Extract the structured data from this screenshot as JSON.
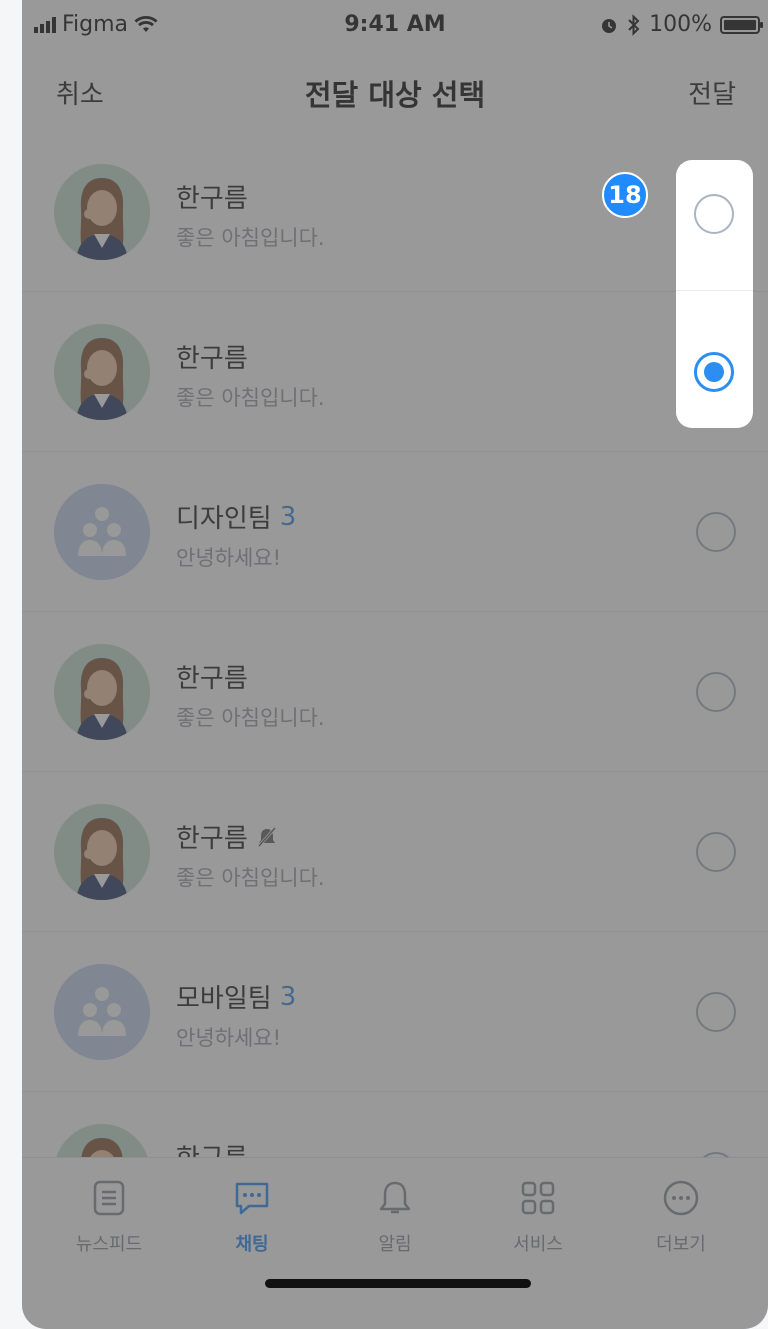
{
  "status_bar": {
    "carrier": "Figma",
    "time": "9:41 AM",
    "battery": "100%"
  },
  "header": {
    "cancel_label": "취소",
    "title": "전달 대상 선택",
    "send_label": "전달"
  },
  "list": [
    {
      "type": "person",
      "name": "한구름",
      "message": "좋은 아침입니다.",
      "selected": false,
      "muted": false
    },
    {
      "type": "person",
      "name": "한구름",
      "message": "좋은 아침입니다.",
      "selected": true,
      "muted": false
    },
    {
      "type": "group",
      "name": "디자인팀",
      "count": "3",
      "message": "안녕하세요!",
      "selected": false,
      "muted": false
    },
    {
      "type": "person",
      "name": "한구름",
      "message": "좋은 아침입니다.",
      "selected": false,
      "muted": false
    },
    {
      "type": "person",
      "name": "한구름",
      "message": "좋은 아침입니다.",
      "selected": false,
      "muted": true
    },
    {
      "type": "group",
      "name": "모바일팀",
      "count": "3",
      "message": "안녕하세요!",
      "selected": false,
      "muted": false
    },
    {
      "type": "person",
      "name": "한구름",
      "message": "",
      "selected": false,
      "muted": false
    }
  ],
  "annotation_badge": "18",
  "tabbar": {
    "items": [
      {
        "label": "뉴스피드",
        "icon": "newsfeed-icon",
        "active": false
      },
      {
        "label": "채팅",
        "icon": "chat-icon",
        "active": true
      },
      {
        "label": "알림",
        "icon": "bell-icon",
        "active": false
      },
      {
        "label": "서비스",
        "icon": "grid-icon",
        "active": false
      },
      {
        "label": "더보기",
        "icon": "more-icon",
        "active": false
      }
    ]
  },
  "colors": {
    "accent": "#2b8ef0",
    "badge": "#1f8bff",
    "group_avatar": "#c3d4ee"
  }
}
